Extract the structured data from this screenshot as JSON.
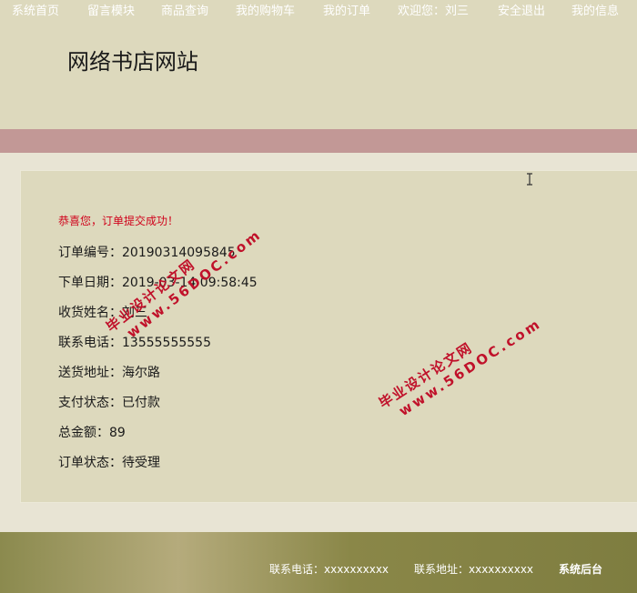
{
  "header": {
    "site_title": "网络书店网站"
  },
  "nav": {
    "items": [
      {
        "label": "系统首页"
      },
      {
        "label": "留言模块"
      },
      {
        "label": "商品查询"
      },
      {
        "label": "我的购物车"
      },
      {
        "label": "我的订单"
      },
      {
        "label": "欢迎您：刘三"
      },
      {
        "label": "安全退出"
      },
      {
        "label": "我的信息"
      }
    ]
  },
  "order": {
    "success_message": "恭喜您，订单提交成功！",
    "fields": [
      {
        "text": "订单编号：20190314095845"
      },
      {
        "text": "下单日期：2019-03-14 09:58:45"
      },
      {
        "text": "收货姓名：刘三"
      },
      {
        "text": "联系电话：13555555555"
      },
      {
        "text": "送货地址：海尔路"
      },
      {
        "text": "支付状态：已付款"
      },
      {
        "text": "总金额：89"
      },
      {
        "text": "订单状态：待受理"
      }
    ]
  },
  "watermark": {
    "line1": "毕业设计论文网",
    "line2": "www.56DOC.com"
  },
  "footer": {
    "phone": "联系电话：xxxxxxxxxx",
    "address": "联系地址：xxxxxxxxxx",
    "admin_link": "系统后台"
  },
  "colors": {
    "header_bg": "#ddd9bd",
    "nav_bg": "#c29896",
    "success_text": "#d0021b",
    "watermark": "#c0112a"
  }
}
